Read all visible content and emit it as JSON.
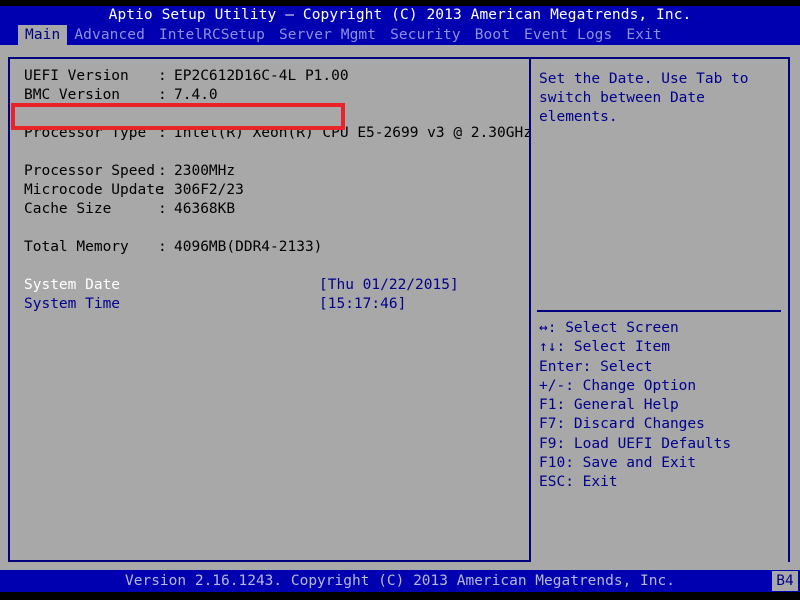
{
  "title": "Aptio Setup Utility – Copyright (C) 2013 American Megatrends, Inc.",
  "menu": {
    "items": [
      {
        "label": "Main",
        "active": true
      },
      {
        "label": "Advanced",
        "active": false
      },
      {
        "label": "IntelRCSetup",
        "active": false
      },
      {
        "label": "Server Mgmt",
        "active": false
      },
      {
        "label": "Security",
        "active": false
      },
      {
        "label": "Boot",
        "active": false
      },
      {
        "label": "Event Logs",
        "active": false
      },
      {
        "label": "Exit",
        "active": false
      }
    ]
  },
  "main": {
    "info_rows": [
      {
        "label": "UEFI Version",
        "sep": ":",
        "value": "EP2C612D16C-4L P1.00"
      },
      {
        "label": "BMC Version",
        "sep": ":",
        "value": "7.4.0"
      },
      {
        "spacer": true
      },
      {
        "label": "Processor Type",
        "sep": ":",
        "value": "Intel(R) Xeon(R) CPU E5-2699 v3 @ 2.30GHz"
      },
      {
        "spacer": true
      },
      {
        "label": "Processor Speed",
        "sep": ":",
        "value": "2300MHz"
      },
      {
        "label": "Microcode Update",
        "sep": ":",
        "value": "306F2/23"
      },
      {
        "label": "Cache Size",
        "sep": ":",
        "value": "46368KB"
      },
      {
        "spacer": true
      },
      {
        "label": "Total Memory",
        "sep": ":",
        "value": "4096MB(DDR4-2133)"
      },
      {
        "spacer": true
      }
    ],
    "datetime_rows": [
      {
        "label": "System Date",
        "value": "[Thu 01/22/2015]",
        "selected": true
      },
      {
        "label": "System Time",
        "value": "[15:17:46]",
        "selected": false
      }
    ]
  },
  "help": {
    "description_lines": [
      "Set the Date. Use Tab to",
      "switch between Date elements."
    ],
    "keys": [
      "↔: Select Screen",
      "↑↓: Select Item",
      "Enter: Select",
      "+/-: Change Option",
      "F1: General Help",
      "F7: Discard Changes",
      "F9: Load UEFI Defaults",
      "F10: Save and Exit",
      "ESC: Exit"
    ]
  },
  "footer": {
    "text": "Version 2.16.1243. Copyright (C) 2013 American Megatrends, Inc.",
    "badge": "B4"
  },
  "annotation": {
    "target": "UEFI Version",
    "color": "#e8232a"
  },
  "colors": {
    "title_bar_bg": "#0000b0",
    "body_bg": "#a8a8a8",
    "border": "#00007e",
    "text_blue": "#00008c",
    "text_white": "#ffffff",
    "menu_inactive": "#8f8fe0",
    "annotation_red": "#e8232a"
  }
}
